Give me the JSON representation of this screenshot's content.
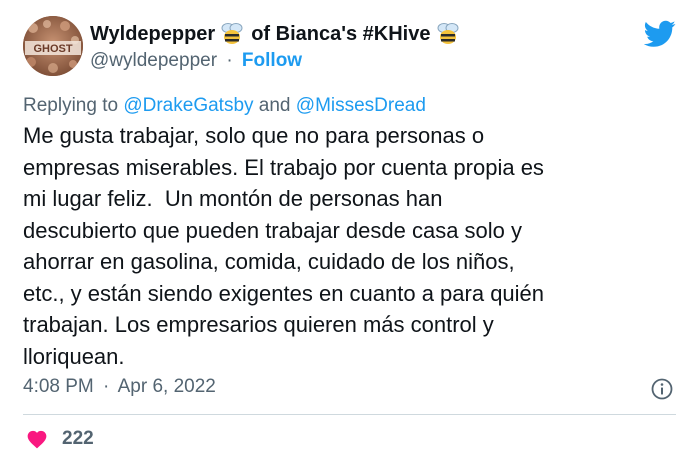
{
  "user": {
    "display_name_part1": "Wyldepepper",
    "display_name_part2": "of Bianca's #KHive",
    "handle": "@wyldepepper",
    "separator": "·",
    "follow_label": "Follow",
    "avatar_text": "GHOST"
  },
  "reply": {
    "prefix": "Replying to",
    "mention1": "@DrakeGatsby",
    "conjunction": "and",
    "mention2": "@MissesDread"
  },
  "tweet": {
    "lines": [
      "Me gusta trabajar, solo que no para personas o",
      "empresas miserables. El trabajo por cuenta propia es",
      "mi lugar feliz.  Un montón de personas han",
      "descubierto que pueden trabajar desde casa solo y",
      "ahorrar en gasolina, comida, cuidado de los niños,",
      "etc., y están siendo exigentes en cuanto a para quién",
      "trabajan. Los empresarios quieren más control y",
      "lloriquean."
    ]
  },
  "meta": {
    "time": "4:08 PM",
    "separator": "·",
    "date": "Apr 6, 2022"
  },
  "engagement": {
    "likes": "222"
  },
  "icons": {
    "bee": "bee-emoji-icon",
    "twitter": "twitter-bird-icon",
    "info": "info-icon",
    "heart": "heart-icon"
  },
  "colors": {
    "link": "#1d9bf0",
    "secondary_text": "#536471",
    "heart": "#f91880"
  }
}
